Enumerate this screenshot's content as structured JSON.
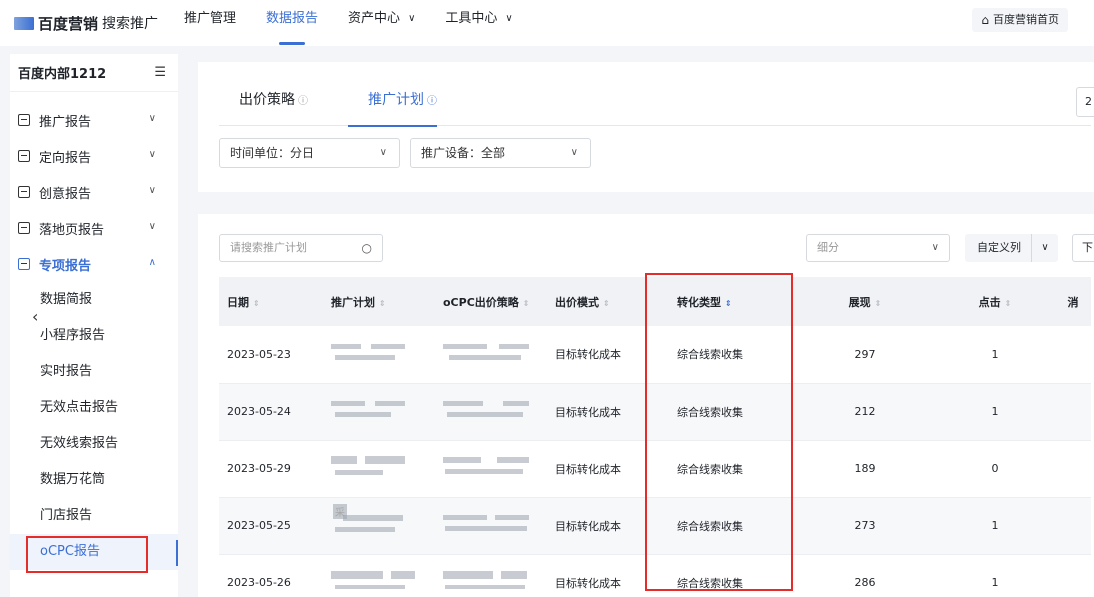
{
  "topbar": {
    "brand": "百度营销",
    "brand_sub": "搜索推广",
    "nav": [
      {
        "label": "推广管理",
        "caret": ""
      },
      {
        "label": "数据报告",
        "caret": ""
      },
      {
        "label": "资产中心",
        "caret": "∨"
      },
      {
        "label": "工具中心",
        "caret": "∨"
      }
    ],
    "home_label": "百度营销首页"
  },
  "sidebar": {
    "account": "百度内部1212",
    "groups": [
      {
        "label": "推广报告"
      },
      {
        "label": "定向报告"
      },
      {
        "label": "创意报告"
      },
      {
        "label": "落地页报告"
      },
      {
        "label": "专项报告"
      }
    ],
    "subitems": [
      "数据简报",
      "小程序报告",
      "实时报告",
      "无效点击报告",
      "无效线索报告",
      "数据万花筒",
      "门店报告",
      "oCPC报告"
    ]
  },
  "filters": {
    "tabs": [
      "出价策略",
      "推广计划"
    ],
    "time_unit": "时间单位：分日",
    "device": "推广设备：全部",
    "edge_btn": "2"
  },
  "table_toolbar": {
    "search_placeholder": "请搜索推广计划",
    "breakdown_placeholder": "细分",
    "custom_columns": "自定义列",
    "download": "下"
  },
  "table": {
    "headers": [
      "日期",
      "推广计划",
      "oCPC出价策略",
      "出价模式",
      "转化类型",
      "展现",
      "点击",
      "消"
    ],
    "rows": [
      {
        "date": "2023-05-23",
        "mode": "目标转化成本",
        "conv": "综合线索收集",
        "impressions": "297",
        "clicks": "1"
      },
      {
        "date": "2023-05-24",
        "mode": "目标转化成本",
        "conv": "综合线索收集",
        "impressions": "212",
        "clicks": "1"
      },
      {
        "date": "2023-05-29",
        "mode": "目标转化成本",
        "conv": "综合线索收集",
        "impressions": "189",
        "clicks": "0"
      },
      {
        "date": "2023-05-25",
        "mode": "目标转化成本",
        "conv": "综合线索收集",
        "impressions": "273",
        "clicks": "1"
      },
      {
        "date": "2023-05-26",
        "mode": "目标转化成本",
        "conv": "综合线索收集",
        "impressions": "286",
        "clicks": "1"
      }
    ],
    "row4_plan_tip": "采"
  },
  "colors": {
    "accent": "#3b6fd4",
    "highlight": "#e62b2b"
  }
}
